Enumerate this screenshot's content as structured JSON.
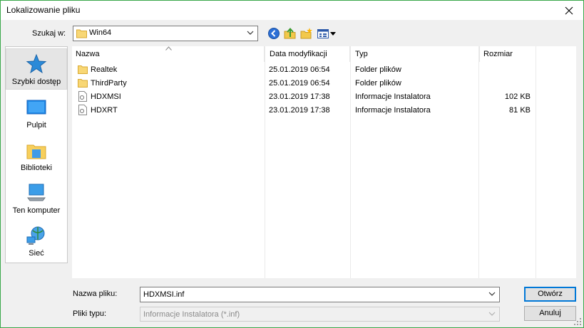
{
  "window": {
    "title": "Lokalizowanie pliku"
  },
  "lookin": {
    "label": "Szukaj w:",
    "value": "Win64"
  },
  "places": [
    {
      "label": "Szybki dostęp",
      "icon": "star-icon",
      "selected": true
    },
    {
      "label": "Pulpit",
      "icon": "desktop-icon"
    },
    {
      "label": "Biblioteki",
      "icon": "libraries-icon"
    },
    {
      "label": "Ten komputer",
      "icon": "computer-icon"
    },
    {
      "label": "Sieć",
      "icon": "network-icon"
    }
  ],
  "columns": {
    "name": "Nazwa",
    "date": "Data modyfikacji",
    "type": "Typ",
    "size": "Rozmiar"
  },
  "files": [
    {
      "name": "Realtek",
      "date": "25.01.2019 06:54",
      "type": "Folder plików",
      "size": "",
      "icon": "folder-icon"
    },
    {
      "name": "ThirdParty",
      "date": "25.01.2019 06:54",
      "type": "Folder plików",
      "size": "",
      "icon": "folder-icon"
    },
    {
      "name": "HDXMSI",
      "date": "23.01.2019 17:38",
      "type": "Informacje Instalatora",
      "size": "102 KB",
      "icon": "inf-file-icon"
    },
    {
      "name": "HDXRT",
      "date": "23.01.2019 17:38",
      "type": "Informacje Instalatora",
      "size": "81 KB",
      "icon": "inf-file-icon"
    }
  ],
  "filename": {
    "label": "Nazwa pliku:",
    "value": "HDXMSI.inf"
  },
  "filetype": {
    "label": "Pliki typu:",
    "value": "Informacje Instalatora (*.inf)"
  },
  "buttons": {
    "open": "Otwórz",
    "cancel": "Anuluj"
  }
}
